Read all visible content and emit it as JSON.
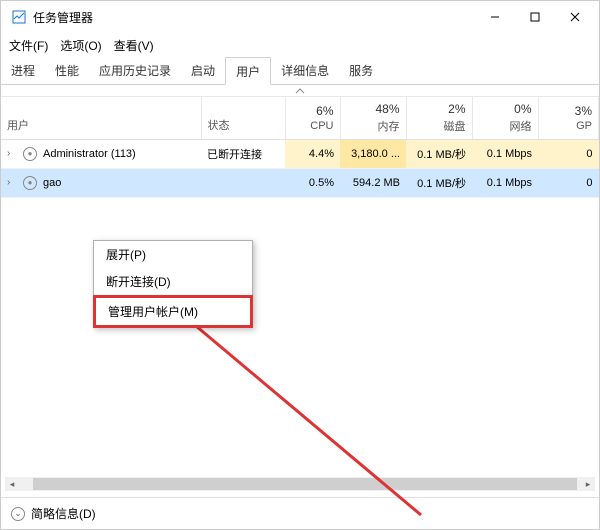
{
  "window": {
    "title": "任务管理器"
  },
  "menu": {
    "file": "文件(F)",
    "options": "选项(O)",
    "view": "查看(V)"
  },
  "tabs": {
    "processes": "进程",
    "performance": "性能",
    "app_history": "应用历史记录",
    "startup": "启动",
    "users": "用户",
    "details": "详细信息",
    "services": "服务"
  },
  "headers": {
    "user": "用户",
    "status": "状态",
    "cpu_pct": "6%",
    "cpu_lbl": "CPU",
    "mem_pct": "48%",
    "mem_lbl": "内存",
    "disk_pct": "2%",
    "disk_lbl": "磁盘",
    "net_pct": "0%",
    "net_lbl": "网络",
    "gpu_pct": "3%",
    "gpu_lbl": "GP"
  },
  "rows": [
    {
      "name": "Administrator (113)",
      "status": "已断开连接",
      "cpu": "4.4%",
      "mem": "3,180.0 ...",
      "disk": "0.1 MB/秒",
      "net": "0.1 Mbps",
      "gpu": "0"
    },
    {
      "name": "gao",
      "status": "",
      "cpu": "0.5%",
      "mem": "594.2 MB",
      "disk": "0.1 MB/秒",
      "net": "0.1 Mbps",
      "gpu": "0"
    }
  ],
  "context_menu": {
    "expand": "展开(P)",
    "disconnect": "断开连接(D)",
    "manage": "管理用户帐户(M)"
  },
  "footer": {
    "brief": "简略信息(D)"
  }
}
